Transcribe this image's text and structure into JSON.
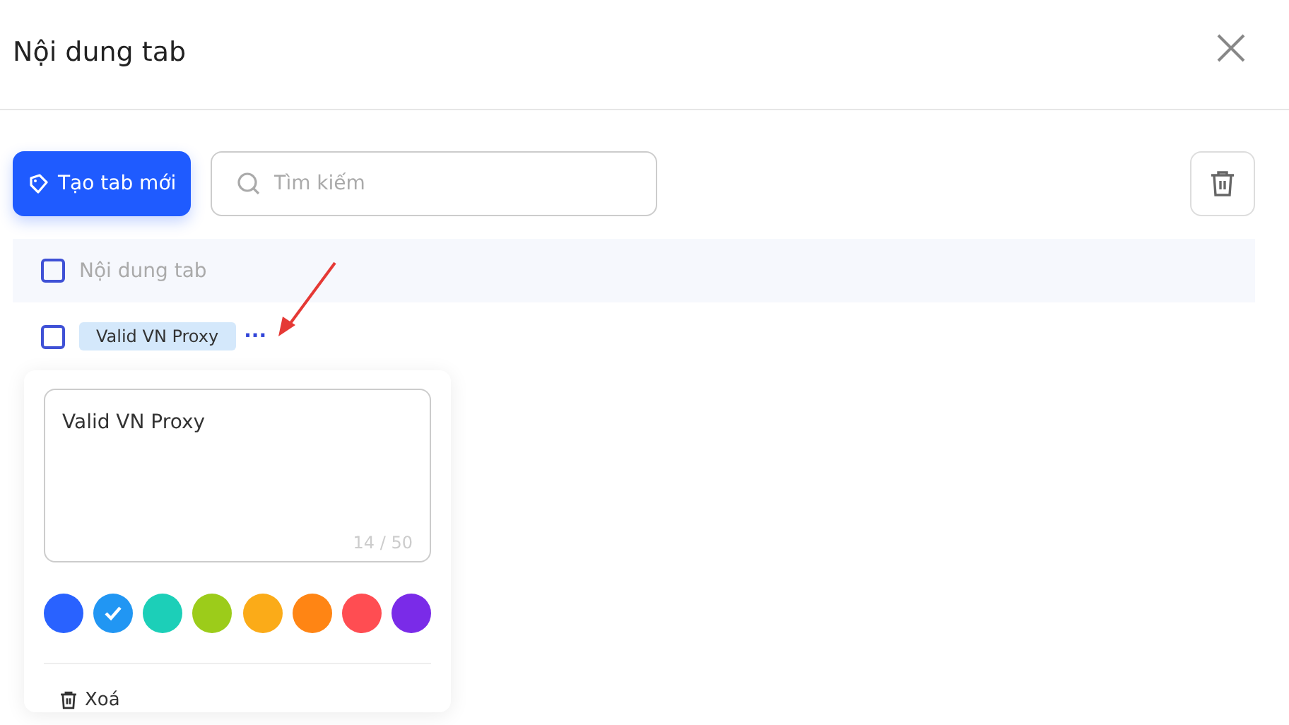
{
  "title": "Nội dung tab",
  "toolbar": {
    "create_button": "Tạo tab mới",
    "search": {
      "placeholder": "Tìm kiếm"
    }
  },
  "list_header": {
    "label": "Nội dung tab",
    "checked": false
  },
  "rows": [
    {
      "label": "Valid VN Proxy",
      "checked": false,
      "more": "···"
    }
  ],
  "editor": {
    "value": "Valid VN Proxy",
    "counter": "14 / 50",
    "colors": [
      {
        "color": "#2962ff",
        "selected": false
      },
      {
        "color": "#2196f3",
        "selected": true
      },
      {
        "color": "#1ccfb8",
        "selected": false
      },
      {
        "color": "#9ccc1a",
        "selected": false
      },
      {
        "color": "#fbab18",
        "selected": false
      },
      {
        "color": "#ff8514",
        "selected": false
      },
      {
        "color": "#ff4d52",
        "selected": false
      },
      {
        "color": "#7a2be8",
        "selected": false
      }
    ],
    "delete_label": "Xoá"
  }
}
